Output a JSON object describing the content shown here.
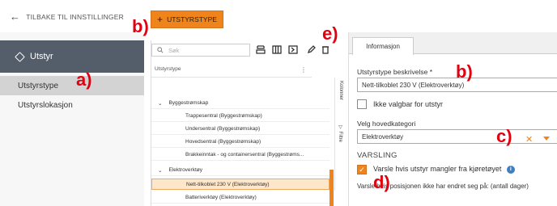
{
  "topbar": {
    "back_label": "TILBAKE TIL INNSTILLINGER",
    "add_button_label": "UTSTYRSTYPE"
  },
  "sidebar": {
    "title": "Utstyr",
    "items": [
      {
        "label": "Utstyrstype",
        "active": true
      },
      {
        "label": "Utstyrslokasjon",
        "active": false
      }
    ]
  },
  "list": {
    "search_placeholder": "Søk",
    "column_header": "Utstyrstype",
    "side_labels": {
      "columns": "Kolonner",
      "filters": "Filtre"
    },
    "rows": [
      {
        "type": "group",
        "label": "Byggestrømskap"
      },
      {
        "type": "child",
        "label": "Trappesentral (Byggestrømskap)"
      },
      {
        "type": "child",
        "label": "Undersentral (Byggestrømskap)"
      },
      {
        "type": "child",
        "label": "Hovedsentral (Byggestrømskap)"
      },
      {
        "type": "child",
        "label": "Brakkeinntak - og containersentral (Byggestrøms..."
      },
      {
        "type": "group",
        "label": "Elektroverktøy"
      },
      {
        "type": "child",
        "label": "Nett-tilkoblet 230 V (Elektroverktøy)",
        "selected": true
      },
      {
        "type": "child",
        "label": "Batteriverktøy (Elektroverktøy)"
      }
    ]
  },
  "detail": {
    "tab_label": "Informasjon",
    "description_label": "Utstyrstype beskrivelse *",
    "description_value": "Nett-tilkoblet 230 V (Elektroverktøy)",
    "not_selectable_label": "Ikke valgbar for utstyr",
    "main_category_label": "Velg hovedkategori",
    "main_category_value": "Elektroverktøy",
    "varsling_heading": "VARSLING",
    "notify_missing_label": "Varsle hvis utstyr mangler fra kjøretøyet",
    "notify_position_label": "Varsle hvis posisjonen ikke har endret seg på: (antall dager)"
  },
  "annotations": {
    "a": "a)",
    "b_top": "b)",
    "b_right": "b)",
    "c": "c)",
    "d": "d)",
    "e": "e)"
  },
  "colors": {
    "accent": "#f0841c",
    "sidebar_header": "#545d6a",
    "annotation": "#e3000f"
  }
}
